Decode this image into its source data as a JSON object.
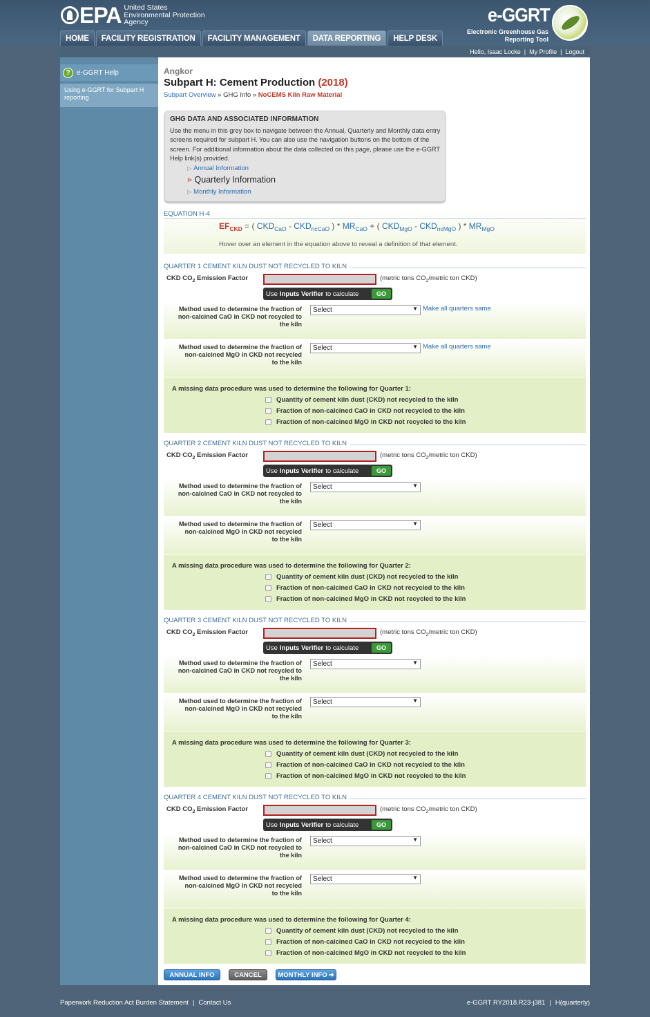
{
  "header": {
    "agency_line1": "United States",
    "agency_line2": "Environmental Protection",
    "agency_line3": "Agency",
    "epa_mark": "EPA",
    "tool_title": "e-GGRT",
    "tool_sub1": "Electronic Greenhouse Gas",
    "tool_sub2": "Reporting Tool"
  },
  "nav": {
    "tabs": [
      {
        "label": "HOME"
      },
      {
        "label": "FACILITY REGISTRATION"
      },
      {
        "label": "FACILITY MANAGEMENT"
      },
      {
        "label": "DATA REPORTING"
      },
      {
        "label": "HELP DESK"
      }
    ]
  },
  "userbar": {
    "greeting": "Hello, Isaac Locke",
    "profile": "My Profile",
    "logout": "Logout"
  },
  "sidebar": {
    "help_title": "e-GGRT Help",
    "help_link": "Using e-GGRT for Subpart H reporting"
  },
  "page": {
    "facility": "Angkor",
    "title": "Subpart H: Cement Production",
    "year": "(2018)",
    "crumb1": "Subpart Overview",
    "crumb2": "GHG Info",
    "crumb3": "NoCEMS Kiln Raw Material"
  },
  "ghg": {
    "title": "GHG DATA AND ASSOCIATED INFORMATION",
    "text": "Use the menu in this grey box to navigate between the Annual, Quarterly and Monthly data entry screens required for subpart H. You can also use the navigation buttons on the bottom of the screen. For additional information about the data collected on this page, please use the e-GGRT Help link(s) provided.",
    "link_annual": "Annual Information",
    "link_quarterly": "Quarterly Information",
    "link_monthly": "Monthly Information"
  },
  "equation": {
    "label": "EQUATION H-4",
    "hint": "Hover over an element in the equation above to reveal a definition of that element."
  },
  "quarters": [
    {
      "title": "QUARTER 1 CEMENT KILN DUST NOT RECYCLED TO KILN",
      "missing_title": "A missing data procedure was used to determine the following for Quarter 1:"
    },
    {
      "title": "QUARTER 2 CEMENT KILN DUST NOT RECYCLED TO KILN",
      "missing_title": "A missing data procedure was used to determine the following for Quarter 2:"
    },
    {
      "title": "QUARTER 3 CEMENT KILN DUST NOT RECYCLED TO KILN",
      "missing_title": "A missing data procedure was used to determine the following for Quarter 3:"
    },
    {
      "title": "QUARTER 4 CEMENT KILN DUST NOT RECYCLED TO KILN",
      "missing_title": "A missing data procedure was used to determine the following for Quarter 4:"
    }
  ],
  "labels": {
    "verifier_use": "Use",
    "verifier_bold": "Inputs Verifier",
    "verifier_rest": "to calculate",
    "go": "GO",
    "method_cao_1": "Method used to determine the fraction of",
    "method_cao_2": "non-calcined CaO in CKD not recycled to",
    "method_cao_3": "the kiln",
    "method_mgo_1": "Method used to determine the fraction of",
    "method_mgo_2": "non-calcined MgO in CKD not recycled",
    "method_mgo_3": "to the kiln",
    "select": "Select",
    "make_same": "Make all quarters same",
    "cb1": "Quantity of cement kiln dust (CKD) not recycled to the kiln",
    "cb2": "Fraction of non-calcined CaO in CKD not recycled to the kiln",
    "cb3": "Fraction of non-calcined MgO in CKD not recycled to the kiln"
  },
  "buttons": {
    "annual": "ANNUAL INFO",
    "cancel": "CANCEL",
    "monthly": "MONTHLY INFO"
  },
  "footer": {
    "paperwork": "Paperwork Reduction Act Burden Statement",
    "contact": "Contact Us",
    "version": "e-GGRT RY2018.R23-j381",
    "mode": "H(quarterly)"
  },
  "colors": {
    "accent_red": "#c0392b",
    "link_blue": "#2a6db0",
    "section_green": "#e3efc6",
    "header_blue": "#3c5670"
  }
}
